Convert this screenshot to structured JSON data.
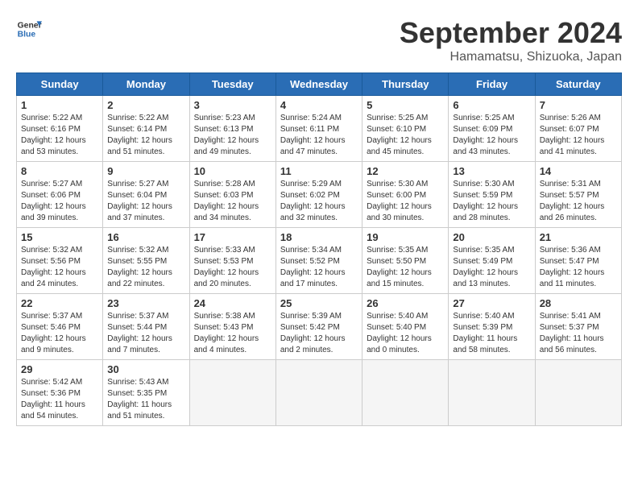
{
  "header": {
    "logo_line1": "General",
    "logo_line2": "Blue",
    "month": "September 2024",
    "location": "Hamamatsu, Shizuoka, Japan"
  },
  "weekdays": [
    "Sunday",
    "Monday",
    "Tuesday",
    "Wednesday",
    "Thursday",
    "Friday",
    "Saturday"
  ],
  "weeks": [
    [
      {
        "day": "1",
        "info": "Sunrise: 5:22 AM\nSunset: 6:16 PM\nDaylight: 12 hours\nand 53 minutes."
      },
      {
        "day": "2",
        "info": "Sunrise: 5:22 AM\nSunset: 6:14 PM\nDaylight: 12 hours\nand 51 minutes."
      },
      {
        "day": "3",
        "info": "Sunrise: 5:23 AM\nSunset: 6:13 PM\nDaylight: 12 hours\nand 49 minutes."
      },
      {
        "day": "4",
        "info": "Sunrise: 5:24 AM\nSunset: 6:11 PM\nDaylight: 12 hours\nand 47 minutes."
      },
      {
        "day": "5",
        "info": "Sunrise: 5:25 AM\nSunset: 6:10 PM\nDaylight: 12 hours\nand 45 minutes."
      },
      {
        "day": "6",
        "info": "Sunrise: 5:25 AM\nSunset: 6:09 PM\nDaylight: 12 hours\nand 43 minutes."
      },
      {
        "day": "7",
        "info": "Sunrise: 5:26 AM\nSunset: 6:07 PM\nDaylight: 12 hours\nand 41 minutes."
      }
    ],
    [
      {
        "day": "8",
        "info": "Sunrise: 5:27 AM\nSunset: 6:06 PM\nDaylight: 12 hours\nand 39 minutes."
      },
      {
        "day": "9",
        "info": "Sunrise: 5:27 AM\nSunset: 6:04 PM\nDaylight: 12 hours\nand 37 minutes."
      },
      {
        "day": "10",
        "info": "Sunrise: 5:28 AM\nSunset: 6:03 PM\nDaylight: 12 hours\nand 34 minutes."
      },
      {
        "day": "11",
        "info": "Sunrise: 5:29 AM\nSunset: 6:02 PM\nDaylight: 12 hours\nand 32 minutes."
      },
      {
        "day": "12",
        "info": "Sunrise: 5:30 AM\nSunset: 6:00 PM\nDaylight: 12 hours\nand 30 minutes."
      },
      {
        "day": "13",
        "info": "Sunrise: 5:30 AM\nSunset: 5:59 PM\nDaylight: 12 hours\nand 28 minutes."
      },
      {
        "day": "14",
        "info": "Sunrise: 5:31 AM\nSunset: 5:57 PM\nDaylight: 12 hours\nand 26 minutes."
      }
    ],
    [
      {
        "day": "15",
        "info": "Sunrise: 5:32 AM\nSunset: 5:56 PM\nDaylight: 12 hours\nand 24 minutes."
      },
      {
        "day": "16",
        "info": "Sunrise: 5:32 AM\nSunset: 5:55 PM\nDaylight: 12 hours\nand 22 minutes."
      },
      {
        "day": "17",
        "info": "Sunrise: 5:33 AM\nSunset: 5:53 PM\nDaylight: 12 hours\nand 20 minutes."
      },
      {
        "day": "18",
        "info": "Sunrise: 5:34 AM\nSunset: 5:52 PM\nDaylight: 12 hours\nand 17 minutes."
      },
      {
        "day": "19",
        "info": "Sunrise: 5:35 AM\nSunset: 5:50 PM\nDaylight: 12 hours\nand 15 minutes."
      },
      {
        "day": "20",
        "info": "Sunrise: 5:35 AM\nSunset: 5:49 PM\nDaylight: 12 hours\nand 13 minutes."
      },
      {
        "day": "21",
        "info": "Sunrise: 5:36 AM\nSunset: 5:47 PM\nDaylight: 12 hours\nand 11 minutes."
      }
    ],
    [
      {
        "day": "22",
        "info": "Sunrise: 5:37 AM\nSunset: 5:46 PM\nDaylight: 12 hours\nand 9 minutes."
      },
      {
        "day": "23",
        "info": "Sunrise: 5:37 AM\nSunset: 5:44 PM\nDaylight: 12 hours\nand 7 minutes."
      },
      {
        "day": "24",
        "info": "Sunrise: 5:38 AM\nSunset: 5:43 PM\nDaylight: 12 hours\nand 4 minutes."
      },
      {
        "day": "25",
        "info": "Sunrise: 5:39 AM\nSunset: 5:42 PM\nDaylight: 12 hours\nand 2 minutes."
      },
      {
        "day": "26",
        "info": "Sunrise: 5:40 AM\nSunset: 5:40 PM\nDaylight: 12 hours\nand 0 minutes."
      },
      {
        "day": "27",
        "info": "Sunrise: 5:40 AM\nSunset: 5:39 PM\nDaylight: 11 hours\nand 58 minutes."
      },
      {
        "day": "28",
        "info": "Sunrise: 5:41 AM\nSunset: 5:37 PM\nDaylight: 11 hours\nand 56 minutes."
      }
    ],
    [
      {
        "day": "29",
        "info": "Sunrise: 5:42 AM\nSunset: 5:36 PM\nDaylight: 11 hours\nand 54 minutes."
      },
      {
        "day": "30",
        "info": "Sunrise: 5:43 AM\nSunset: 5:35 PM\nDaylight: 11 hours\nand 51 minutes."
      },
      {
        "day": "",
        "info": ""
      },
      {
        "day": "",
        "info": ""
      },
      {
        "day": "",
        "info": ""
      },
      {
        "day": "",
        "info": ""
      },
      {
        "day": "",
        "info": ""
      }
    ]
  ]
}
